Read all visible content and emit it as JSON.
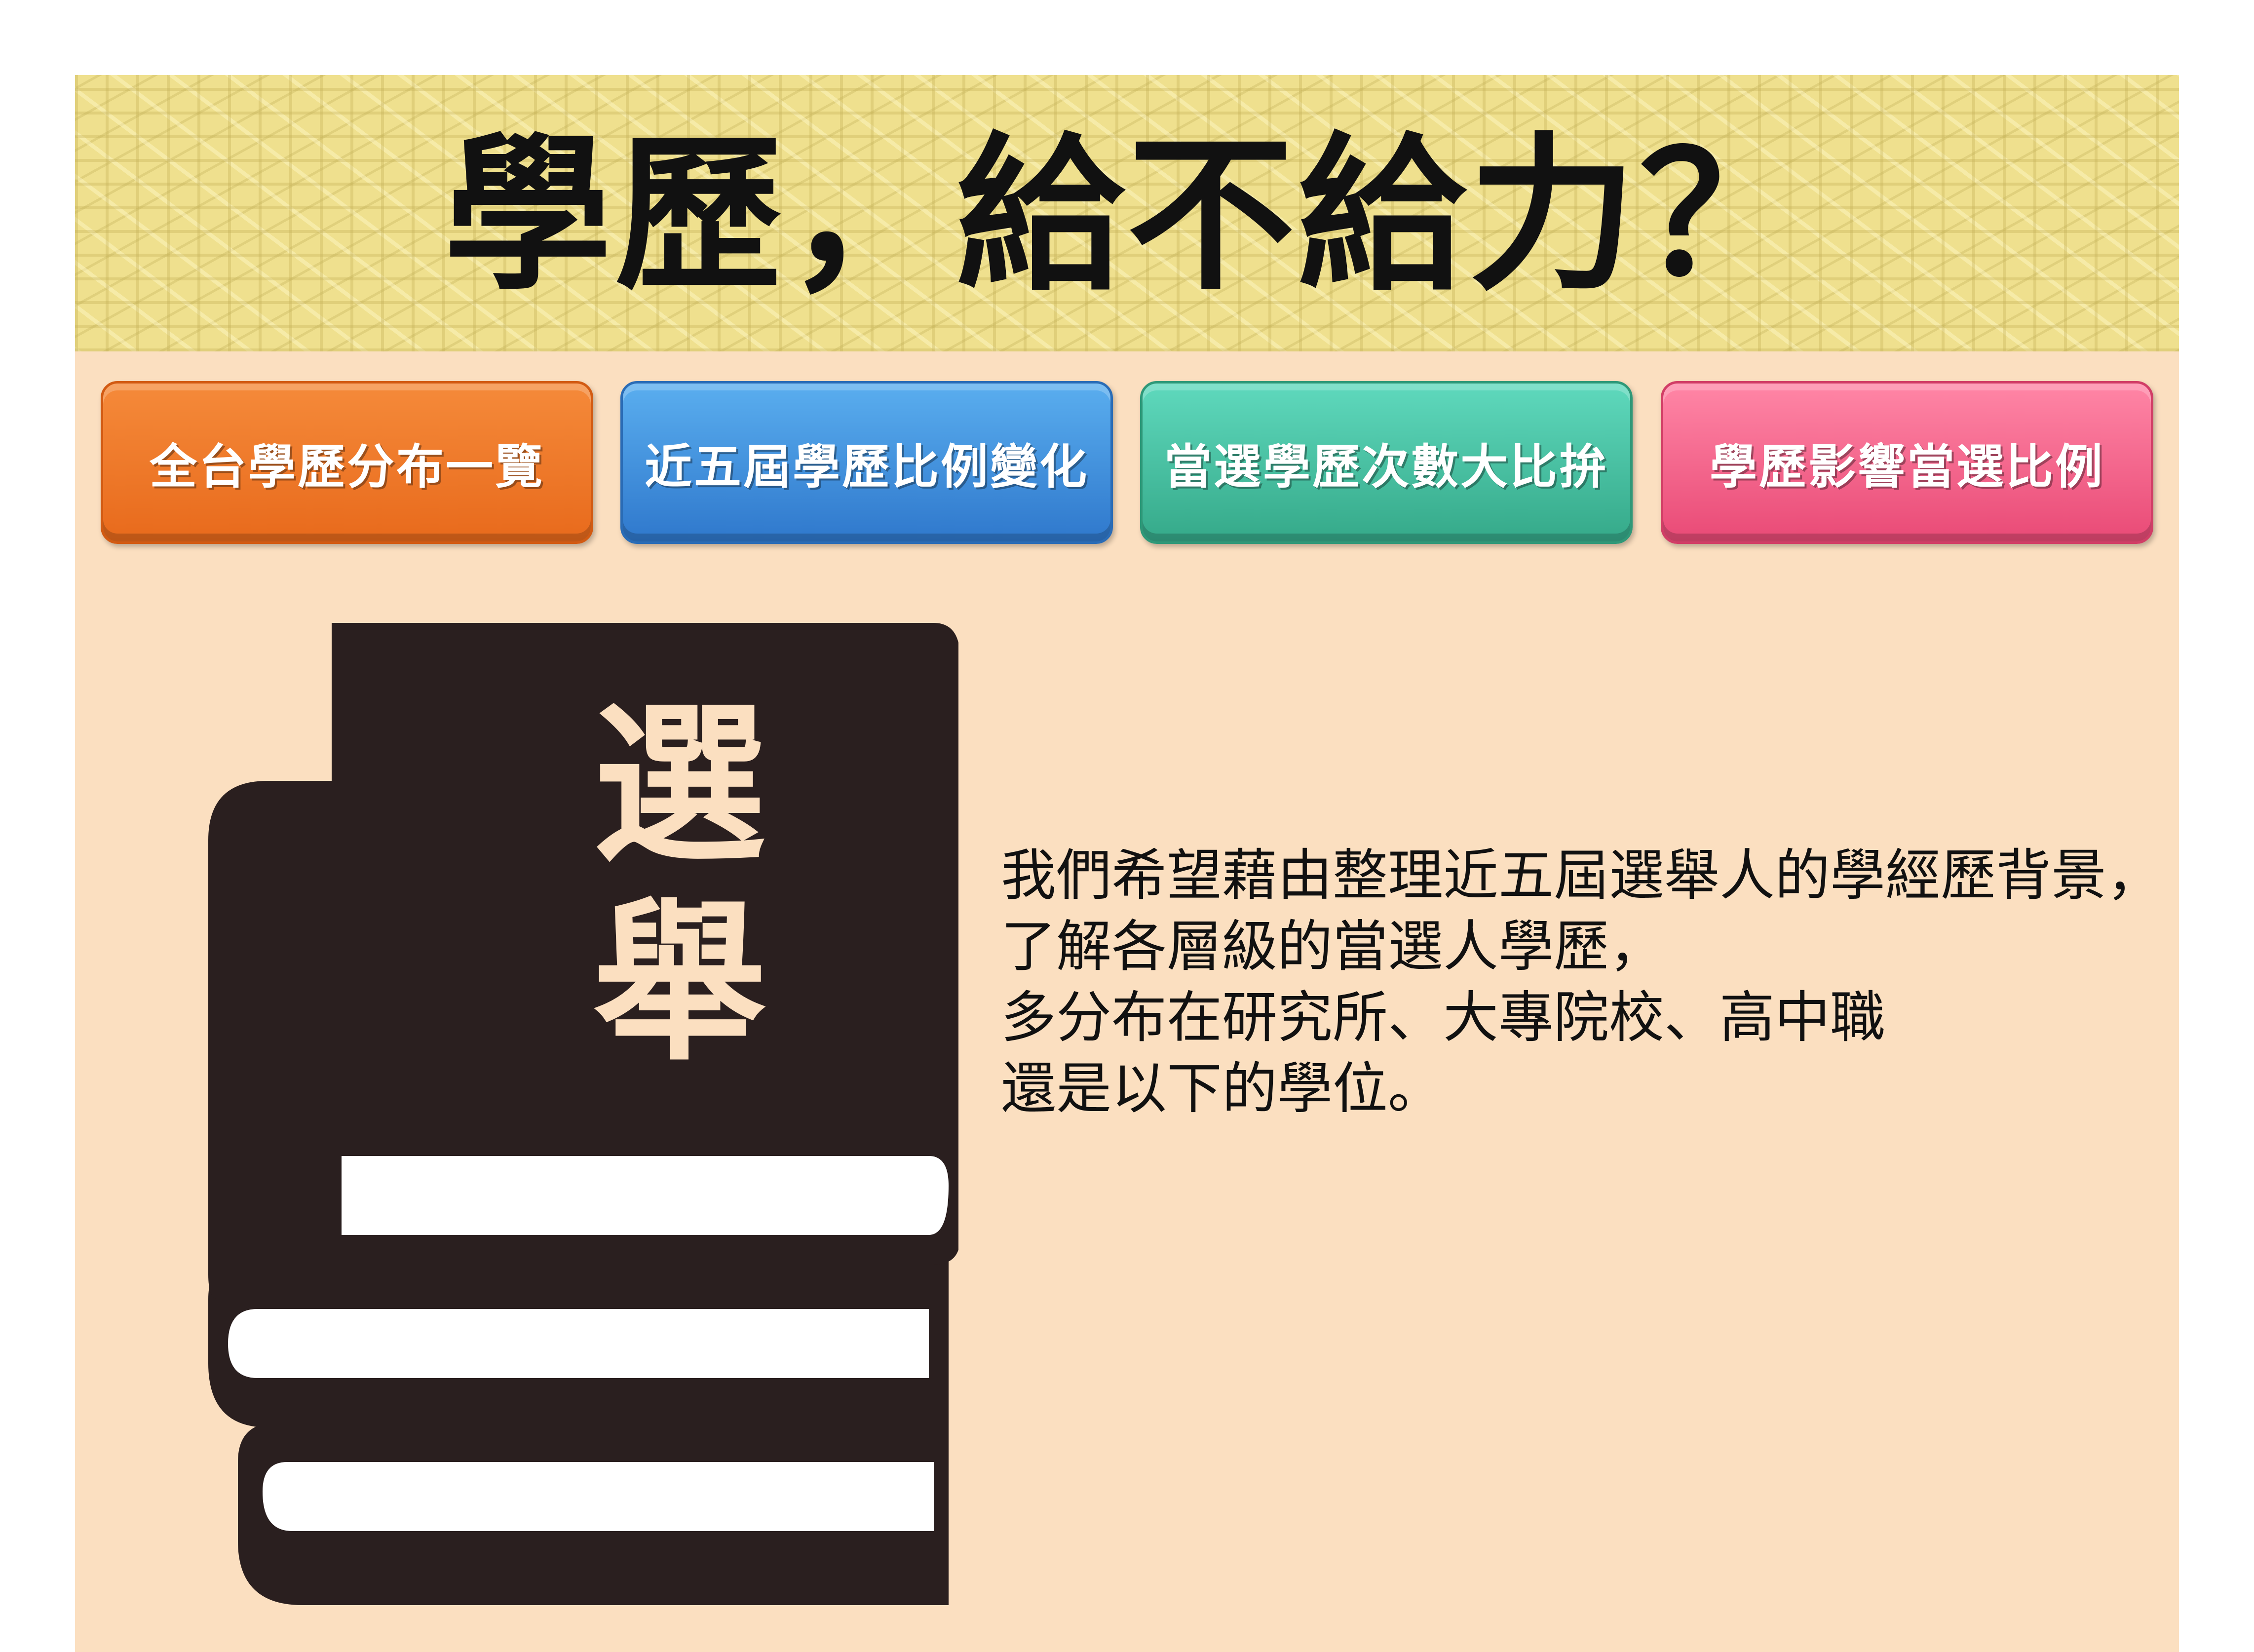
{
  "header": {
    "title": "學歷，給不給力？"
  },
  "nav": {
    "buttons": [
      {
        "label": "全台學歷分布一覽",
        "color": "#ee7a28"
      },
      {
        "label": "近五屆學歷比例變化",
        "color": "#3b86d8"
      },
      {
        "label": "當選學歷次數大比拚",
        "color": "#44b99a"
      },
      {
        "label": "學歷影響當選比例",
        "color": "#f25d86"
      }
    ]
  },
  "illustration": {
    "icon": "book-stack-icon",
    "label_line1": "選",
    "label_line2": "舉"
  },
  "description": {
    "lines": [
      "我們希望藉由整理近五屆選舉人的學經歷背景，",
      "了解各層級的當選人學歷，",
      "多分布在研究所、大專院校、高中職",
      "還是以下的學位。"
    ]
  }
}
